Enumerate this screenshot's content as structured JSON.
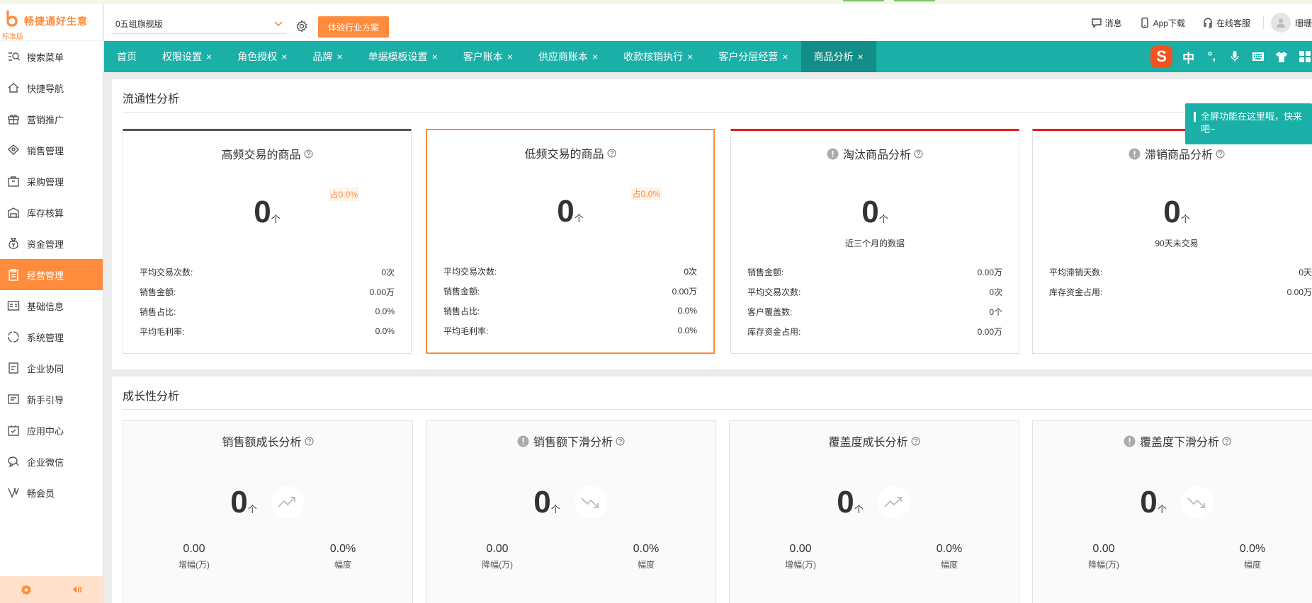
{
  "app": {
    "name": "畅捷通好生意",
    "edition": "标准版"
  },
  "sidebar": {
    "items": [
      {
        "label": "搜索菜单",
        "icon": "search-menu-icon"
      },
      {
        "label": "快捷导航",
        "icon": "home-icon"
      },
      {
        "label": "营销推广",
        "icon": "gift-icon"
      },
      {
        "label": "销售管理",
        "icon": "sales-icon"
      },
      {
        "label": "采购管理",
        "icon": "purchase-bag-icon"
      },
      {
        "label": "库存核算",
        "icon": "warehouse-icon"
      },
      {
        "label": "资金管理",
        "icon": "money-bag-icon"
      },
      {
        "label": "经营管理",
        "icon": "clipboard-icon",
        "active": true
      },
      {
        "label": "基础信息",
        "icon": "id-card-icon"
      },
      {
        "label": "系统管理",
        "icon": "system-cycle-icon"
      },
      {
        "label": "企业协同",
        "icon": "collaboration-icon"
      },
      {
        "label": "新手引导",
        "icon": "guide-doc-icon"
      },
      {
        "label": "应用中心",
        "icon": "app-center-icon"
      },
      {
        "label": "企业微信",
        "icon": "wecom-icon"
      },
      {
        "label": "畅会员",
        "icon": "vip-icon"
      }
    ],
    "footer_icons": [
      "settings-gear-icon",
      "collapse-sidebar-icon"
    ]
  },
  "header": {
    "account": "0五组旗舰版",
    "trial_button": "体验行业方案",
    "messages": "消息",
    "app_download": "App下载",
    "support": "在线客服",
    "user": "珊珊"
  },
  "tabs": [
    {
      "label": "首页",
      "closable": false
    },
    {
      "label": "权限设置",
      "closable": true
    },
    {
      "label": "角色授权",
      "closable": true
    },
    {
      "label": "品牌",
      "closable": true
    },
    {
      "label": "单据模板设置",
      "closable": true
    },
    {
      "label": "客户账本",
      "closable": true
    },
    {
      "label": "供应商账本",
      "closable": true
    },
    {
      "label": "收款核销执行",
      "closable": true
    },
    {
      "label": "客户分层经营",
      "closable": true
    },
    {
      "label": "商品分析",
      "closable": true,
      "active": true
    }
  ],
  "tab_close_glyph": "×",
  "ime_toolbar": {
    "logo": "S",
    "mode": "中",
    "punct": "°,"
  },
  "guide_tip": {
    "line1": "全屏功能在这里哦，快来",
    "line2": "吧~"
  },
  "liquidity": {
    "title": "流通性分析",
    "cards": [
      {
        "title": "高频交易的商品",
        "value": "0",
        "unit": "个",
        "badge": "占0.0%",
        "rows": [
          {
            "label": "平均交易次数:",
            "value": "0次"
          },
          {
            "label": "销售金额:",
            "value": "0.00万"
          },
          {
            "label": "销售占比:",
            "value": "0.0%"
          },
          {
            "label": "平均毛利率:",
            "value": "0.0%"
          }
        ]
      },
      {
        "title": "低频交易的商品",
        "value": "0",
        "unit": "个",
        "badge": "占0.0%",
        "rows": [
          {
            "label": "平均交易次数:",
            "value": "0次"
          },
          {
            "label": "销售金额:",
            "value": "0.00万"
          },
          {
            "label": "销售占比:",
            "value": "0.0%"
          },
          {
            "label": "平均毛利率:",
            "value": "0.0%"
          }
        ]
      },
      {
        "title": "淘汰商品分析",
        "value": "0",
        "unit": "个",
        "sub": "近三个月的数据",
        "rows": [
          {
            "label": "销售金额:",
            "value": "0.00万"
          },
          {
            "label": "平均交易次数:",
            "value": "0次"
          },
          {
            "label": "客户覆盖数:",
            "value": "0个"
          },
          {
            "label": "库存资金占用:",
            "value": "0.00万"
          }
        ]
      },
      {
        "title": "滞销商品分析",
        "value": "0",
        "unit": "个",
        "sub": "90天未交易",
        "rows": [
          {
            "label": "平均滞销天数:",
            "value": "0天"
          },
          {
            "label": "库存资金占用:",
            "value": "0.00万"
          }
        ]
      }
    ]
  },
  "growth": {
    "title": "成长性分析",
    "cards": [
      {
        "title": "销售额成长分析",
        "value": "0",
        "unit": "个",
        "trend": "trend-up-icon",
        "m1_value": "0.00",
        "m1_label": "增幅(万)",
        "m2_value": "0.0%",
        "m2_label": "幅度"
      },
      {
        "title": "销售额下滑分析",
        "value": "0",
        "unit": "个",
        "trend": "trend-down-icon",
        "m1_value": "0.00",
        "m1_label": "降幅(万)",
        "m2_value": "0.0%",
        "m2_label": "幅度"
      },
      {
        "title": "覆盖度成长分析",
        "value": "0",
        "unit": "个",
        "trend": "trend-up-icon",
        "m1_value": "0.00",
        "m1_label": "增幅(万)",
        "m2_value": "0.0%",
        "m2_label": "幅度"
      },
      {
        "title": "覆盖度下滑分析",
        "value": "0",
        "unit": "个",
        "trend": "trend-down-icon",
        "m1_value": "0.00",
        "m1_label": "降幅(万)",
        "m2_value": "0.0%",
        "m2_label": "幅度"
      }
    ]
  },
  "colors": {
    "brand_orange": "#ff8b3d",
    "teal": "#1ab0a8",
    "teal_active": "#138d87",
    "danger_red": "#e8191c"
  }
}
